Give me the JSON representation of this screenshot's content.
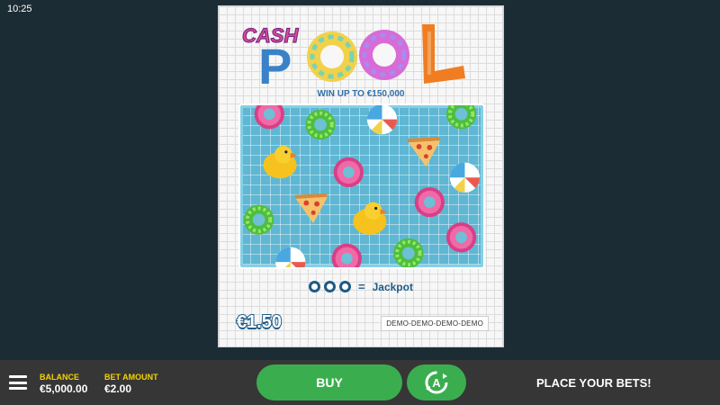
{
  "status_bar": {
    "time": "10:25"
  },
  "ticket": {
    "logo": {
      "word1": "CASH",
      "word2": "POOL"
    },
    "win_up_text": "WIN UP TO €150,000",
    "jackpot_label": "Jackpot",
    "jackpot_equals": "=",
    "price": "€1.50",
    "demo_label": "DEMO-DEMO-DEMO-DEMO",
    "colors": {
      "pool_water": "#5fb7d3",
      "logo_cash": "#e24c8f",
      "logo_p": "#3a82c8",
      "logo_l": "#f07d22"
    },
    "pool_items": [
      "pink-donut-float-icon",
      "green-donut-float-icon",
      "beach-ball-icon",
      "green-donut-float-icon",
      "rubber-duck-icon",
      "pink-donut-float-icon",
      "pizza-float-icon",
      "beach-ball-icon",
      "green-donut-float-icon",
      "pizza-float-icon",
      "rubber-duck-icon",
      "pink-donut-float-icon",
      "pink-donut-float-icon",
      "beach-ball-icon",
      "pink-donut-float-icon",
      "green-donut-float-icon"
    ]
  },
  "bottom_bar": {
    "balance_label": "BALANCE",
    "balance_value": "€5,000.00",
    "bet_label": "BET AMOUNT",
    "bet_value": "€2.00",
    "buy_label": "BUY",
    "autoplay_icon": "autoplay-icon",
    "status_text": "PLACE YOUR BETS!",
    "colors": {
      "button_green": "#3aae4e",
      "label_yellow": "#f5d300"
    }
  }
}
